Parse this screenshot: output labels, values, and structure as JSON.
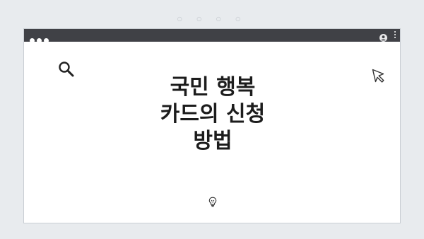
{
  "page": {
    "indicator_dots": "○ ○ ○ ○"
  },
  "window": {
    "titlebar": {
      "dots": [
        "close",
        "minimize",
        "maximize"
      ],
      "icons": [
        "user-icon",
        "kebab-menu-icon"
      ]
    }
  },
  "content": {
    "title_lines": [
      "국민 행복",
      "카드의 신청",
      "방법"
    ],
    "icons": [
      "search-icon",
      "cursor-icon",
      "lightbulb-icon"
    ]
  },
  "colors": {
    "background": "#e8ebee",
    "titlebar": "#404146",
    "window": "#ffffff",
    "text": "#1c1c1c"
  }
}
